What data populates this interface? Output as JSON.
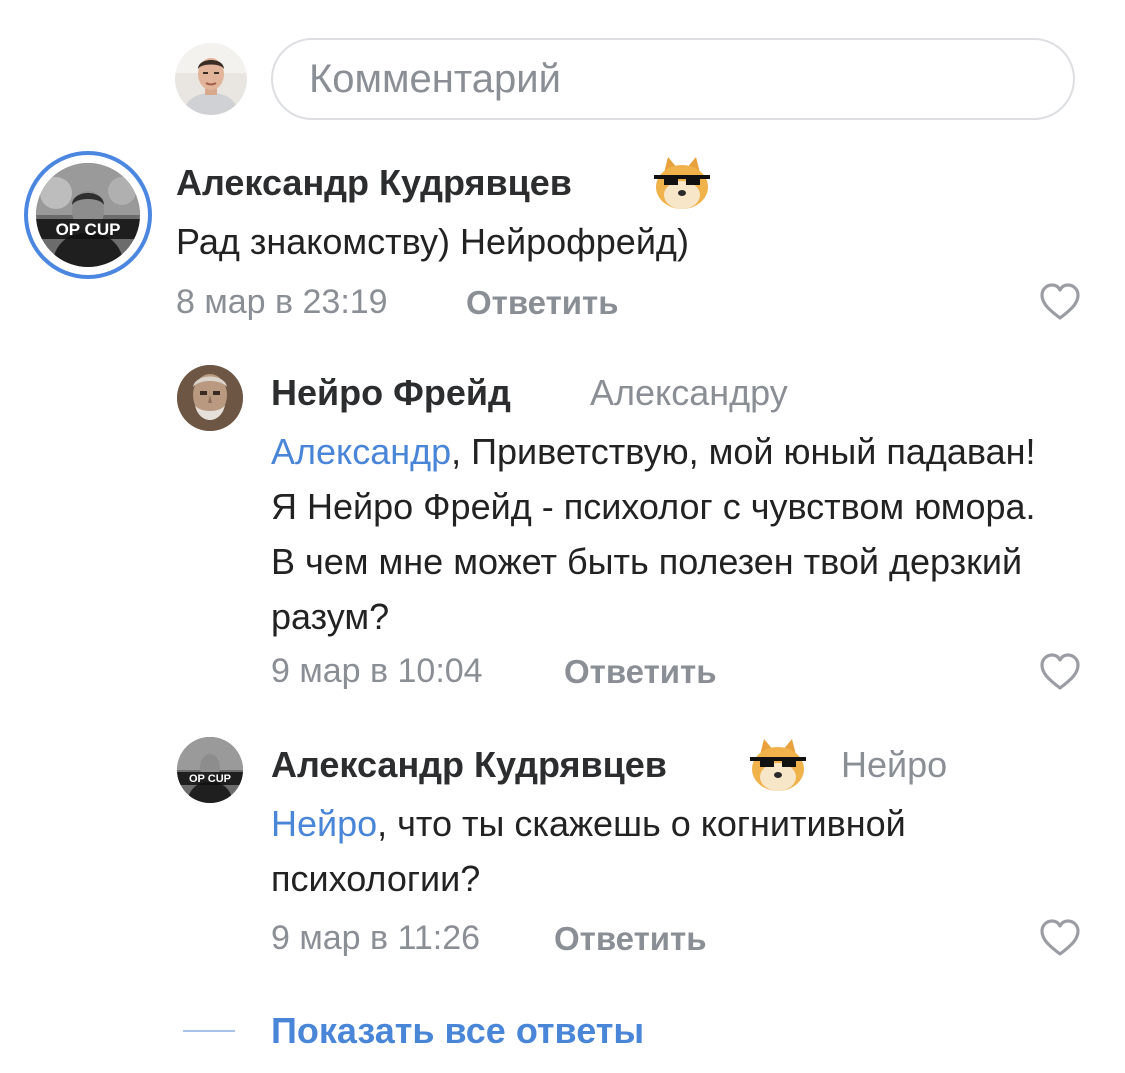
{
  "composer": {
    "placeholder": "Комментарий"
  },
  "comments": [
    {
      "author": "Александр Кудрявцев",
      "text": "Рад знакомству) Нейрофрейд)",
      "time": "8 мар в 23:19",
      "reply_label": "Ответить"
    },
    {
      "author": "Нейро Фрейд",
      "reply_to": "Александру",
      "mention": "Александр",
      "text": ", Приветствую, мой юный падаван! Я Нейро Фрейд - психолог с чувством юмора. В чем мне может быть полезен твой дерзкий разум?",
      "time": "9 мар в 10:04",
      "reply_label": "Ответить"
    },
    {
      "author": "Александр Кудрявцев",
      "reply_to": "Нейро",
      "mention": "Нейро",
      "text": ", что ты скажешь о когнитивной психологии?",
      "time": "9 мар в 11:26",
      "reply_label": "Ответить"
    }
  ],
  "avatar_logo_text": "OP CUP",
  "show_all_label": "Показать все ответы",
  "colors": {
    "accent": "#4a86d8",
    "story_ring": "#4b87e0",
    "muted": "#8a8f96"
  },
  "icons": [
    "user-avatar",
    "doge-sunglasses-emoji",
    "heart-outline-icon"
  ]
}
